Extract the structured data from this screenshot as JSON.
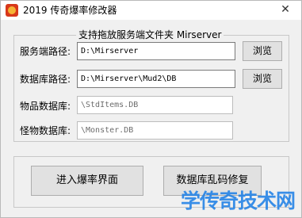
{
  "window": {
    "title": "2019 传奇爆率修改器",
    "close_glyph": "✕"
  },
  "group": {
    "title": "支持拖放服务端文件夹 Mirserver"
  },
  "fields": [
    {
      "label": "服务端路径:",
      "value": "D:\\Mirserver",
      "button": "浏览"
    },
    {
      "label": "数据库路径:",
      "value": "D:\\Mirserver\\Mud2\\DB",
      "button": "浏览"
    },
    {
      "label": "物品数据库:",
      "value": "\\StdItems.DB"
    },
    {
      "label": "怪物数据库:",
      "value": "\\Monster.DB"
    }
  ],
  "actions": {
    "enter_label": "进入爆率界面",
    "repair_label": "数据库乱码修复"
  },
  "watermark": "学传奇技术网",
  "colors": {
    "watermark": "#1a7ee6",
    "icon": "#d8381a"
  }
}
